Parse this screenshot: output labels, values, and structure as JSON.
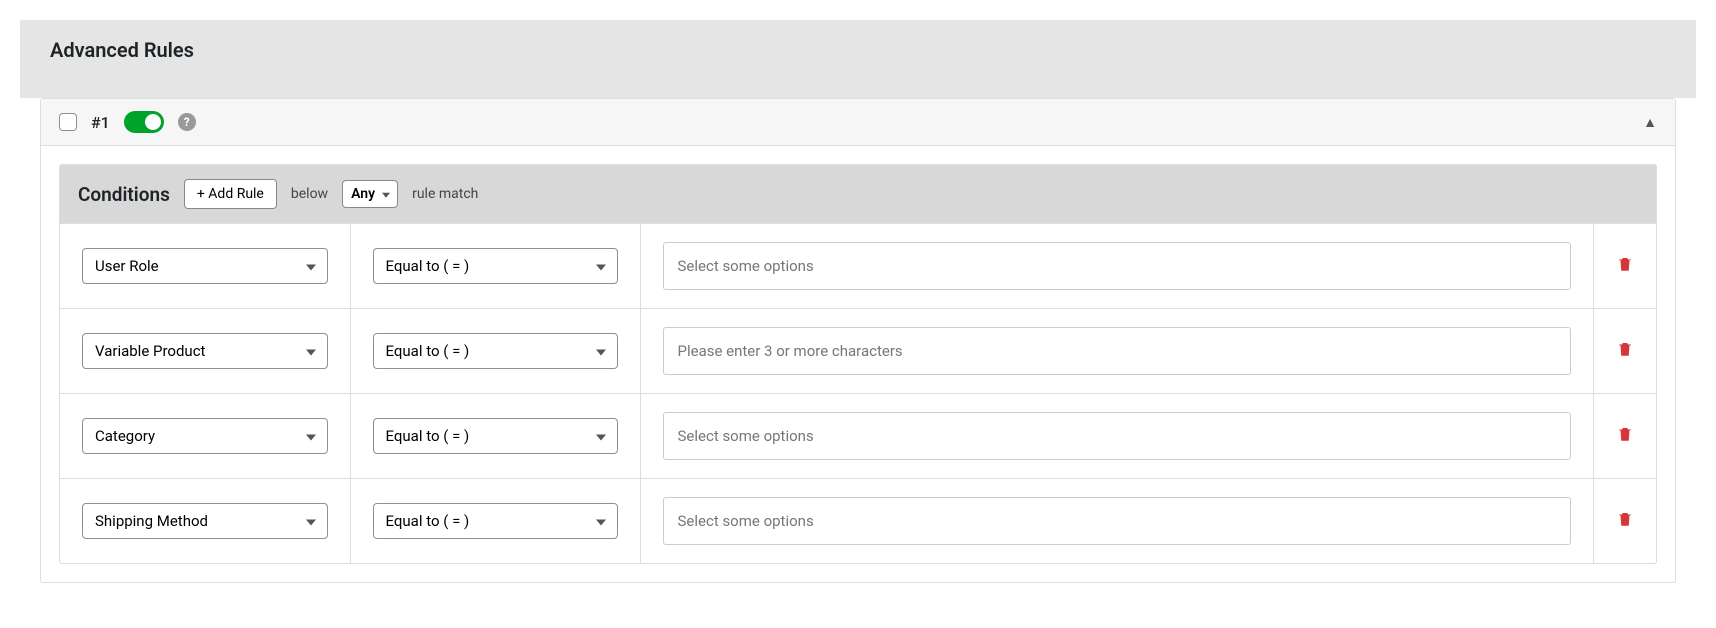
{
  "panel": {
    "title": "Advanced Rules"
  },
  "rule": {
    "number": "#1",
    "help": "?"
  },
  "conditions": {
    "title": "Conditions",
    "add_rule_label": "+ Add Rule",
    "below_label": "below",
    "match_select": "Any",
    "rule_match_label": "rule match"
  },
  "rows": [
    {
      "field": "User Role",
      "operator": "Equal to ( = )",
      "placeholder": "Select some options"
    },
    {
      "field": "Variable Product",
      "operator": "Equal to ( = )",
      "placeholder": "Please enter 3 or more characters"
    },
    {
      "field": "Category",
      "operator": "Equal to ( = )",
      "placeholder": "Select some options"
    },
    {
      "field": "Shipping Method",
      "operator": "Equal to ( = )",
      "placeholder": "Select some options"
    }
  ]
}
